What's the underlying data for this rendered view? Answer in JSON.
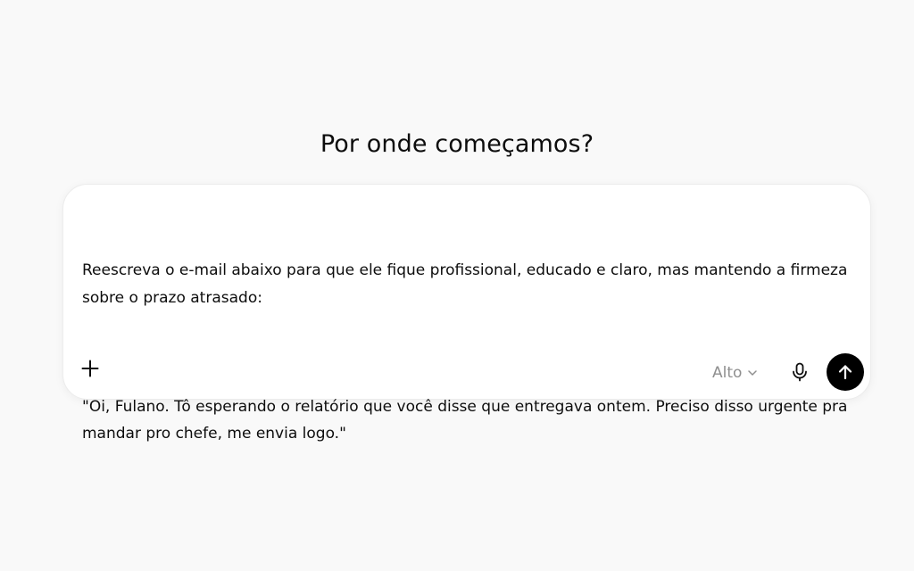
{
  "header": {
    "title": "Por onde começamos?"
  },
  "composer": {
    "text_line_1": "Reescreva o e-mail abaixo para que ele fique profissional, educado e claro, mas mantendo a firmeza sobre o prazo atrasado:",
    "text_line_2": "\"Oi, Fulano. Tô esperando o relatório que você disse que entregava ontem. Preciso disso urgente pra mandar pro chefe, me envia logo.\"",
    "model_label": "Alto",
    "icons": {
      "add": "plus-icon",
      "model_dropdown": "chevron-down-icon",
      "voice": "microphone-icon",
      "send": "arrow-up-icon"
    }
  },
  "colors": {
    "background": "#f9f9f9",
    "composer_bg": "#ffffff",
    "send_button_bg": "#000000",
    "muted_text": "#8f8f8f"
  }
}
